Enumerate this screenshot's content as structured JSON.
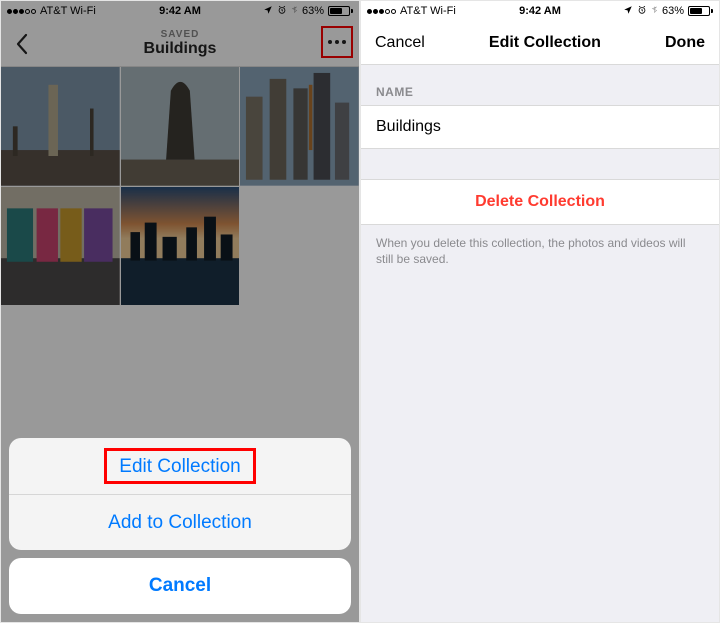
{
  "status": {
    "carrier": "AT&T Wi-Fi",
    "time": "9:42 AM",
    "battery_percent": "63%"
  },
  "left": {
    "saved_label": "SAVED",
    "title": "Buildings",
    "action_sheet": {
      "edit": "Edit Collection",
      "add": "Add to Collection",
      "cancel": "Cancel"
    }
  },
  "right": {
    "nav": {
      "cancel": "Cancel",
      "title": "Edit Collection",
      "done": "Done"
    },
    "section_name": "NAME",
    "name_value": "Buildings",
    "delete": "Delete Collection",
    "footer": "When you delete this collection, the photos and videos will still be saved."
  }
}
